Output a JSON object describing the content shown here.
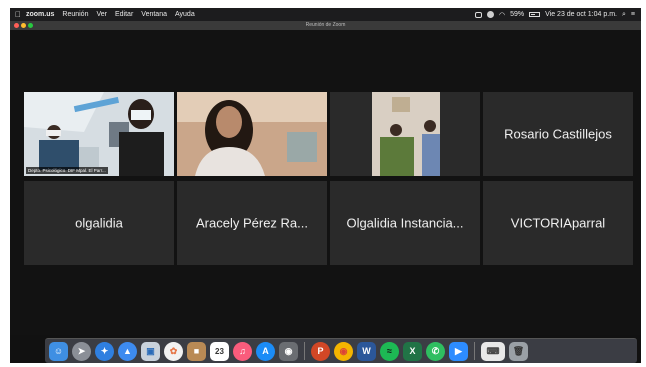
{
  "menubar": {
    "app": "zoom.us",
    "items": [
      "Reunión",
      "Ver",
      "Editar",
      "Ventana",
      "Ayuda"
    ],
    "battery": "59%",
    "clock": "Vie 23 de oct  1:04 p.m."
  },
  "window": {
    "title": "Reunión de Zoom"
  },
  "participants": [
    {
      "name": "Depto. Psicológico. DIF Mpal. El Parr..."
    },
    {
      "name": ""
    },
    {
      "name": ""
    },
    {
      "name": "Rosario Castillejos"
    },
    {
      "name": "olgalidia"
    },
    {
      "name": "Aracely Pérez Ra..."
    },
    {
      "name": "Olgalidia Instancia..."
    },
    {
      "name": "VICTORIAparral"
    }
  ],
  "dock": {
    "calendar_day": "23",
    "apps": [
      "finder-icon",
      "launchpad-icon",
      "safari-icon",
      "app-store-alt-icon",
      "preview-icon",
      "photos-icon",
      "contacts-icon",
      "calendar-icon",
      "music-icon",
      "app-store-icon",
      "screenshot-icon",
      "powerpoint-icon",
      "chrome-icon",
      "word-icon",
      "spotify-icon",
      "excel-icon",
      "whatsapp-icon",
      "zoom-icon",
      "keyboard-icon",
      "trash-icon"
    ],
    "colors": {
      "powerpoint": "#d24726",
      "word": "#2b579a",
      "excel": "#217346",
      "spotify": "#1db954",
      "zoom": "#2d8cff",
      "chrome": "#f4b400"
    }
  }
}
